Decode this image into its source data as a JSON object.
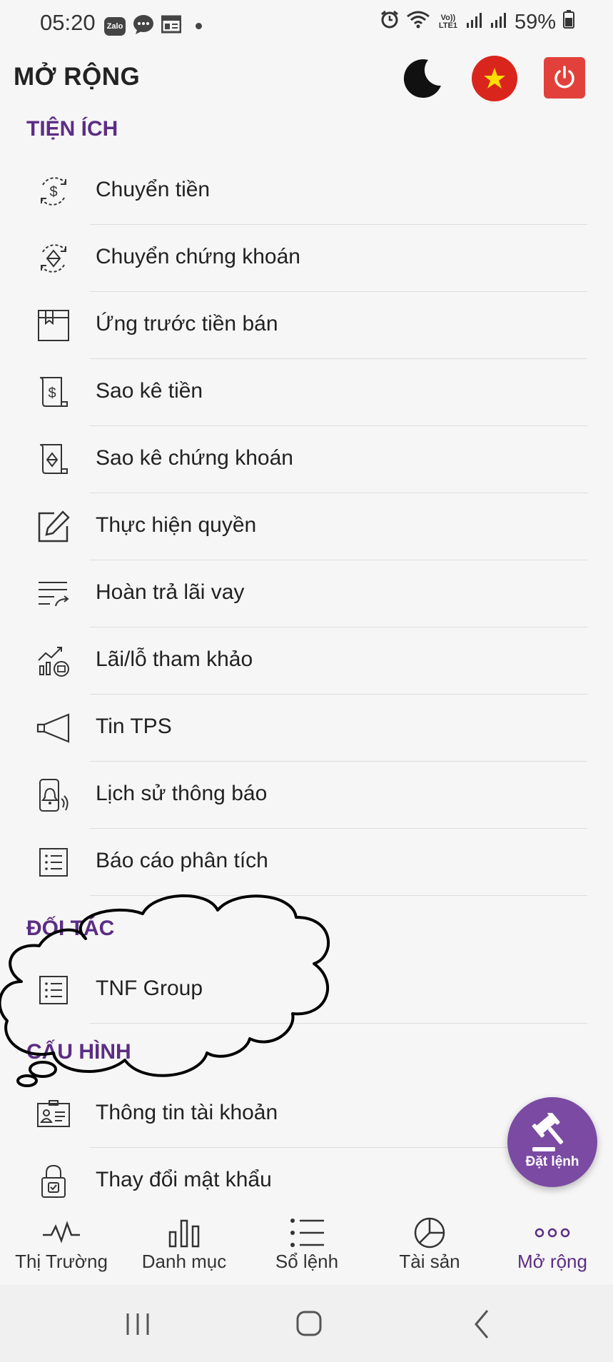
{
  "status_bar": {
    "time": "05:20",
    "left_icons": [
      "zalo-icon",
      "messenger-icon",
      "calendar-icon"
    ],
    "zalo_text": "Zalo",
    "right_icons": [
      "alarm-icon",
      "wifi-icon",
      "volte-icon",
      "signal-icon",
      "signal-icon",
      "battery-icon"
    ],
    "volte_text": "Vo)) LTE1",
    "battery": "59%"
  },
  "header": {
    "title": "MỞ RỘNG",
    "buttons": [
      "moon-icon",
      "vietnam-flag-icon",
      "power-icon"
    ],
    "accent": "#5c2d84"
  },
  "sections": {
    "tien_ich": {
      "title": "TIỆN ÍCH",
      "items": [
        {
          "label": "Chuyển tiền",
          "icon": "money-transfer-icon"
        },
        {
          "label": "Chuyển chứng khoán",
          "icon": "securities-transfer-icon"
        },
        {
          "label": "Ứng trước tiền bán",
          "icon": "advance-payment-icon"
        },
        {
          "label": "Sao kê tiền",
          "icon": "cash-statement-icon"
        },
        {
          "label": "Sao kê chứng khoán",
          "icon": "securities-statement-icon"
        },
        {
          "label": "Thực hiện quyền",
          "icon": "edit-icon"
        },
        {
          "label": "Hoàn trả lãi vay",
          "icon": "repay-list-icon"
        },
        {
          "label": "Lãi/lỗ tham khảo",
          "icon": "profit-chart-icon"
        },
        {
          "label": "Tin TPS",
          "icon": "megaphone-icon"
        },
        {
          "label": "Lịch sử thông báo",
          "icon": "notification-history-icon"
        },
        {
          "label": "Báo cáo phân tích",
          "icon": "list-icon"
        }
      ]
    },
    "doi_tac": {
      "title": "ĐỐI TÁC",
      "items": [
        {
          "label": "TNF Group",
          "icon": "list-icon"
        }
      ]
    },
    "cau_hinh": {
      "title": "CẤU HÌNH",
      "items": [
        {
          "label": "Thông tin tài khoản",
          "icon": "id-card-icon"
        },
        {
          "label": "Thay đổi mật khẩu",
          "icon": "lock-icon"
        }
      ]
    }
  },
  "fab": {
    "label": "Đặt lệnh",
    "icon": "gavel-icon",
    "color": "#7b4aa3"
  },
  "bottom_nav": {
    "tabs": [
      {
        "label": "Thị Trường",
        "icon": "pulse-icon"
      },
      {
        "label": "Danh mục",
        "icon": "bar-chart-icon"
      },
      {
        "label": "Sổ lệnh",
        "icon": "order-list-icon"
      },
      {
        "label": "Tài sản",
        "icon": "pie-chart-icon"
      },
      {
        "label": "Mở rộng",
        "icon": "more-icon"
      }
    ],
    "active_index": 4
  },
  "system_nav": [
    "recents-icon",
    "home-icon",
    "back-icon"
  ]
}
